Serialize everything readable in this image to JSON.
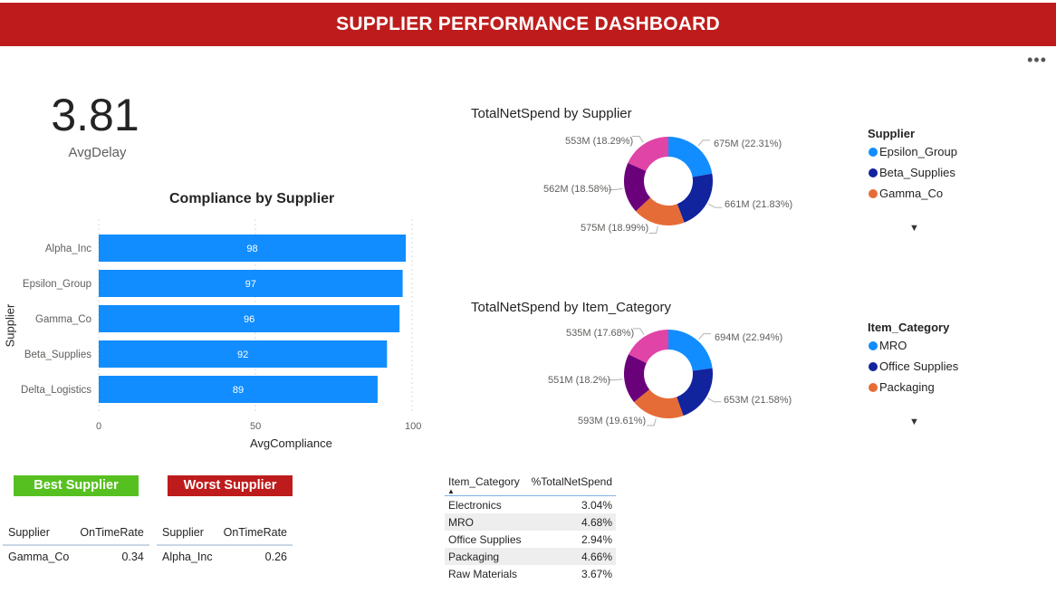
{
  "header": {
    "title": "SUPPLIER PERFORMANCE DASHBOARD"
  },
  "more_menu": "•••",
  "kpi": {
    "value": "3.81",
    "label": "AvgDelay"
  },
  "compliance_chart": {
    "title": "Compliance by Supplier",
    "ylabel": "Supplier",
    "xlabel": "AvgCompliance",
    "ticks": [
      "0",
      "50",
      "100"
    ]
  },
  "spend_by_supplier": {
    "title": "TotalNetSpend by Supplier",
    "legend_title": "Supplier",
    "legend": [
      "Epsilon_Group",
      "Beta_Supplies",
      "Gamma_Co"
    ],
    "labels": [
      "675M (22.31%)",
      "661M (21.83%)",
      "575M (18.99%)",
      "562M (18.58%)",
      "553M (18.29%)"
    ],
    "more_icon": "▼"
  },
  "spend_by_category": {
    "title": "TotalNetSpend by Item_Category",
    "legend_title": "Item_Category",
    "legend": [
      "MRO",
      "Office Supplies",
      "Packaging"
    ],
    "labels": [
      "694M (22.94%)",
      "653M (21.58%)",
      "593M (19.61%)",
      "551M (18.2%)",
      "535M (17.68%)"
    ],
    "more_icon": "▼"
  },
  "best": {
    "badge": "Best Supplier",
    "headers": [
      "Supplier",
      "OnTimeRate"
    ],
    "row": [
      "Gamma_Co",
      "0.34"
    ]
  },
  "worst": {
    "badge": "Worst Supplier",
    "headers": [
      "Supplier",
      "OnTimeRate"
    ],
    "row": [
      "Alpha_Inc",
      "0.26"
    ]
  },
  "category_table": {
    "headers": [
      "Item_Category",
      "%TotalNetSpend"
    ],
    "sort_icon": "▲",
    "rows": [
      [
        "Electronics",
        "3.04%"
      ],
      [
        "MRO",
        "4.68%"
      ],
      [
        "Office Supplies",
        "2.94%"
      ],
      [
        "Packaging",
        "4.66%"
      ],
      [
        "Raw Materials",
        "3.67%"
      ]
    ]
  },
  "colors": {
    "header": "#be1c1c",
    "bar": "#118dff",
    "donut": [
      "#118dff",
      "#12239e",
      "#e66c37",
      "#6b007b",
      "#e044a7"
    ],
    "best": "#57c021",
    "worst": "#be1c1c"
  },
  "chart_data": [
    {
      "type": "bar",
      "title": "Compliance by Supplier",
      "orientation": "horizontal",
      "categories": [
        "Alpha_Inc",
        "Epsilon_Group",
        "Gamma_Co",
        "Beta_Supplies",
        "Delta_Logistics"
      ],
      "values": [
        98,
        97,
        96,
        92,
        89
      ],
      "xlabel": "AvgCompliance",
      "ylabel": "Supplier",
      "xlim": [
        0,
        100
      ],
      "grid": true
    },
    {
      "type": "pie",
      "title": "TotalNetSpend by Supplier",
      "values": [
        675,
        661,
        575,
        562,
        553
      ],
      "percents": [
        22.31,
        21.83,
        18.99,
        18.58,
        18.29
      ],
      "legend": "right"
    },
    {
      "type": "pie",
      "title": "TotalNetSpend by Item_Category",
      "values": [
        694,
        653,
        593,
        551,
        535
      ],
      "percents": [
        22.94,
        21.58,
        19.61,
        18.2,
        17.68
      ],
      "legend": "right"
    }
  ]
}
